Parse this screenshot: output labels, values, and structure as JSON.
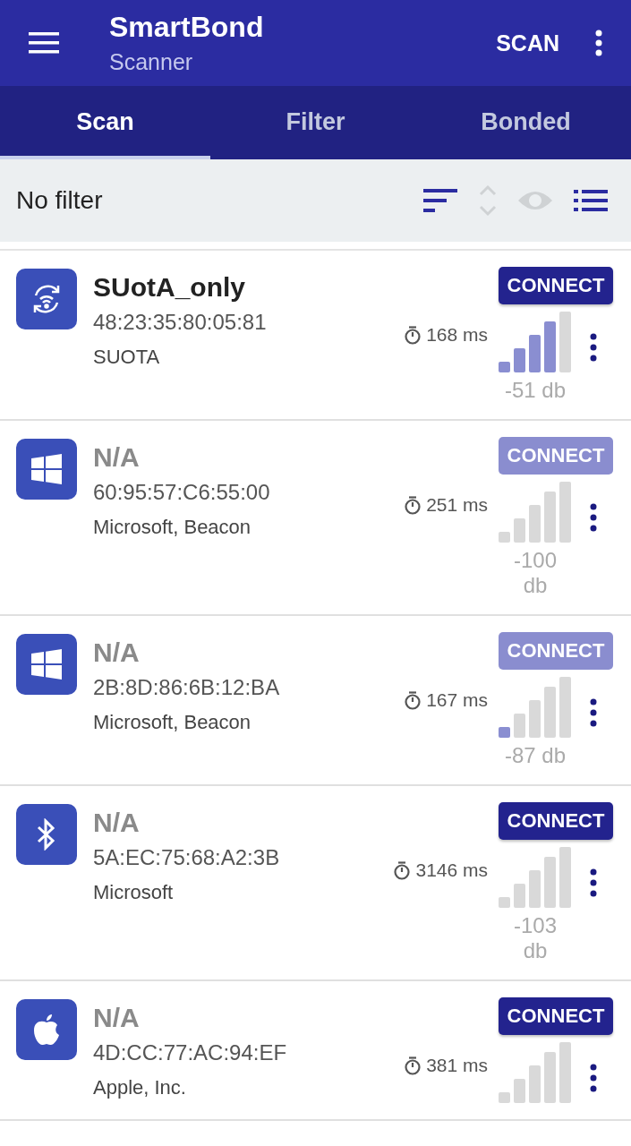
{
  "app_bar": {
    "title": "SmartBond",
    "subtitle": "Scanner",
    "action": "SCAN"
  },
  "tabs": [
    {
      "label": "Scan",
      "selected": true
    },
    {
      "label": "Filter",
      "selected": false
    },
    {
      "label": "Bonded",
      "selected": false
    }
  ],
  "filter_bar": {
    "label": "No filter",
    "tools": [
      {
        "kind": "sort",
        "disabled": false
      },
      {
        "kind": "updown",
        "disabled": true
      },
      {
        "kind": "eye",
        "disabled": true
      },
      {
        "kind": "list",
        "disabled": false
      }
    ]
  },
  "devices": [
    {
      "kind": "suota",
      "name": "SUotA_only",
      "name_known": true,
      "address": "48:23:35:80:05:81",
      "type": "SUOTA",
      "interval": "168 ms",
      "button": "CONNECT",
      "disabled": false,
      "bars": [
        {
          "lit": true
        },
        {
          "lit": true
        },
        {
          "lit": true
        },
        {
          "lit": true
        },
        {
          "lit": false
        }
      ],
      "reading": "-51 db"
    },
    {
      "kind": "windows",
      "name": "N/A",
      "name_known": false,
      "address": "60:95:57:C6:55:00",
      "type": "Microsoft, Beacon",
      "interval": "251 ms",
      "button": "CONNECT",
      "disabled": true,
      "bars": [
        {
          "lit": false
        },
        {
          "lit": false
        },
        {
          "lit": false
        },
        {
          "lit": false
        },
        {
          "lit": false
        }
      ],
      "reading": "-100 db"
    },
    {
      "kind": "windows",
      "name": "N/A",
      "name_known": false,
      "address": "2B:8D:86:6B:12:BA",
      "type": "Microsoft, Beacon",
      "interval": "167 ms",
      "button": "CONNECT",
      "disabled": true,
      "bars": [
        {
          "lit": true
        },
        {
          "lit": false
        },
        {
          "lit": false
        },
        {
          "lit": false
        },
        {
          "lit": false
        }
      ],
      "reading": "-87 db"
    },
    {
      "kind": "bluetooth",
      "name": "N/A",
      "name_known": false,
      "address": "5A:EC:75:68:A2:3B",
      "type": "Microsoft",
      "interval": "3146 ms",
      "button": "CONNECT",
      "disabled": false,
      "bars": [
        {
          "lit": false
        },
        {
          "lit": false
        },
        {
          "lit": false
        },
        {
          "lit": false
        },
        {
          "lit": false
        }
      ],
      "reading": "-103 db"
    },
    {
      "kind": "apple",
      "name": "N/A",
      "name_known": false,
      "address": "4D:CC:77:AC:94:EF",
      "type": "Apple, Inc.",
      "interval": "381 ms",
      "button": "CONNECT",
      "disabled": false,
      "bars": [
        {
          "lit": false
        },
        {
          "lit": false
        },
        {
          "lit": false
        },
        {
          "lit": false
        },
        {
          "lit": false
        }
      ]
    }
  ]
}
